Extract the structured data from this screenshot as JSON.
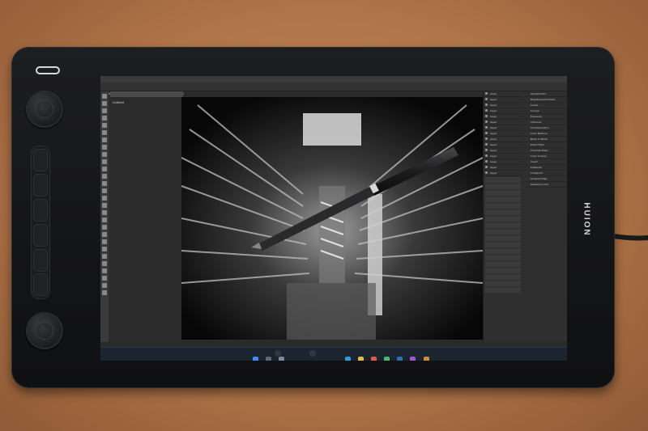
{
  "tablet": {
    "brand": "HUION",
    "dials": 2,
    "keys": 6
  },
  "photoshop": {
    "menu": [
      "Ps",
      "File",
      "Edit",
      "Image",
      "Layer",
      "Type",
      "Select",
      "Filter",
      "3D",
      "View",
      "Plugins",
      "Window",
      "Help"
    ],
    "options_bar": [
      "Auto-Select:",
      "Layer",
      "Show Transform Controls"
    ],
    "doc_tab": "Untitled",
    "status_left": "",
    "layers": [
      "Layer",
      "Layer",
      "Layer",
      "Layer",
      "Layer",
      "Layer",
      "Layer",
      "Layer",
      "Layer",
      "Layer",
      "Layer",
      "Layer",
      "Layer",
      "Layer",
      "Layer"
    ],
    "adjust_items": [
      "Adjustments",
      "Brightness/Contrast",
      "Levels",
      "Curves",
      "Exposure",
      "Vibrance",
      "Hue/Saturation",
      "Color Balance",
      "Black & White",
      "Photo Filter",
      "Channel Mixer",
      "Color Lookup",
      "Invert",
      "Posterize",
      "Threshold",
      "Gradient Map",
      "Selective Color"
    ]
  },
  "taskbar": {
    "left_title": "",
    "pill_left": "",
    "pill_right": "",
    "tray_time": "",
    "tray_date": ""
  },
  "colors": {
    "desk": "#b07448",
    "bezel": "#161719",
    "ps_dark": "#2f2f2f",
    "taskbar": "#1c2430"
  }
}
